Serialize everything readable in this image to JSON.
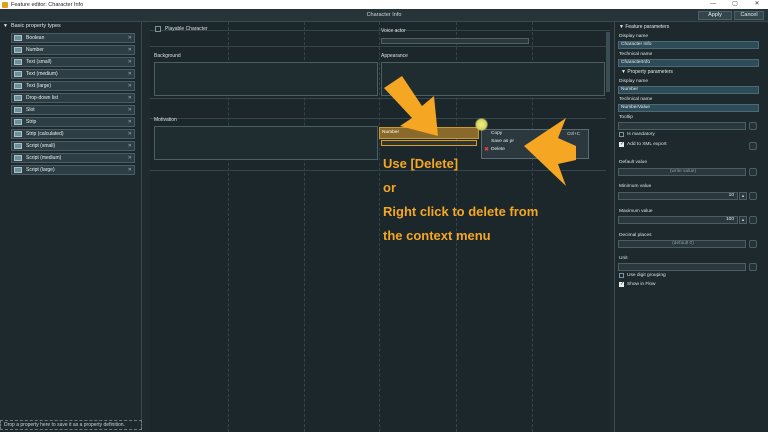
{
  "window": {
    "title": "Feature editor: Character Info",
    "controls": [
      "—",
      "▢",
      "✕"
    ]
  },
  "topbar": {
    "center_title": "Character Info",
    "apply_label": "Apply",
    "cancel_label": "Cancel"
  },
  "left_panel": {
    "header": "Basic property types",
    "items": [
      {
        "label": "Boolean"
      },
      {
        "label": "Number"
      },
      {
        "label": "Text (small)"
      },
      {
        "label": "Text (medium)"
      },
      {
        "label": "Text (large)"
      },
      {
        "label": "Drop-down list"
      },
      {
        "label": "Slot"
      },
      {
        "label": "Strip"
      },
      {
        "label": "Strip (calculated)"
      },
      {
        "label": "Script (small)"
      },
      {
        "label": "Script (medium)"
      },
      {
        "label": "Script (large)"
      }
    ],
    "status": "Drop a property here to save it as a property definition."
  },
  "canvas": {
    "playable_character": "Playable Character",
    "voice_actor": "Voice actor",
    "background": "Background",
    "appearance": "Appearance",
    "motivation": "Motivation",
    "number_field": "Number"
  },
  "context_menu": {
    "items": [
      {
        "label": "Copy",
        "shortcut": "Ctrl+C"
      },
      {
        "label": "Save as pr",
        "shortcut": ""
      },
      {
        "label": "Delete",
        "shortcut": ""
      }
    ]
  },
  "annotation": {
    "line1": "Use [Delete]",
    "line2": "or",
    "line3": "Right click to delete from",
    "line4": "the context menu",
    "color": "#f5a623"
  },
  "right_panel": {
    "feature_header": "Feature parameters",
    "display_name_label": "Display name",
    "display_name_value": "Character Info",
    "technical_name_label": "Technical name",
    "technical_name_value": "CharacterInfo",
    "property_header": "Property parameters",
    "prop_display_name_label": "Display name",
    "prop_display_name_value": "Number",
    "prop_technical_name_label": "Technical name",
    "prop_technical_name_value": "NumberValue",
    "tooltip_label": "Tooltip",
    "is_mandatory": "Is mandatory",
    "add_to_xml": "Add to XML export",
    "default_value_label": "Default value",
    "default_value_placeholder": "(write value)",
    "minimum_value_label": "Minimum value",
    "minimum_value": "10",
    "maximum_value_label": "Maximum value",
    "maximum_value": "100",
    "decimal_places_label": "Decimal places",
    "decimal_places_placeholder": "(default 0)",
    "unit_label": "Unit",
    "use_digit_grouping": "Use digit grouping",
    "show_in_flow": "Show in Flow"
  }
}
